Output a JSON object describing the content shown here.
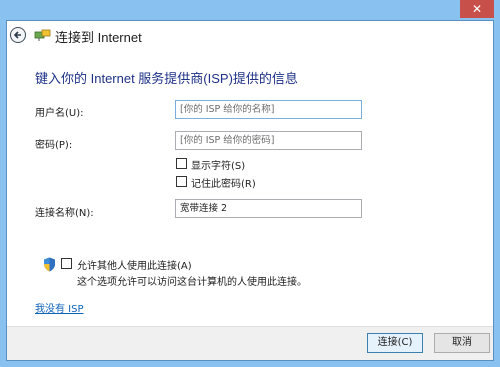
{
  "window": {
    "close_label": "✕"
  },
  "nav": {
    "title": "连接到 Internet"
  },
  "heading": "键入你的 Internet 服务提供商(ISP)提供的信息",
  "form": {
    "username_label": "用户名(U):",
    "username_placeholder": "[你的 ISP 给你的名称]",
    "password_label": "密码(P):",
    "password_placeholder": "[你的 ISP 给你的密码]",
    "show_chars_label": "显示字符(S)",
    "remember_label": "记住此密码(R)",
    "connection_name_label": "连接名称(N):",
    "connection_name_value": "宽带连接 2"
  },
  "sharing": {
    "allow_label": "允许其他人使用此连接(A)",
    "description": "这个选项允许可以访问这台计算机的人使用此连接。"
  },
  "link": {
    "no_isp": "我没有 ISP"
  },
  "footer": {
    "connect_label": "连接(C)",
    "cancel_label": "取消"
  }
}
